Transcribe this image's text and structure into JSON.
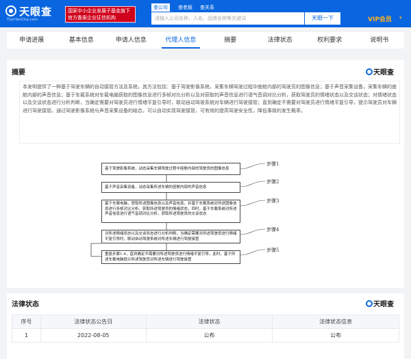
{
  "header": {
    "logo_text": "天眼查",
    "logo_sub": "TianYanCha.com",
    "banner_line1": "国家中小企业发展子基金旗下",
    "banner_line2": "官方备案企业征信机构",
    "search_tabs": [
      "查公司",
      "查老板",
      "查关系"
    ],
    "search_placeholder": "请输入公司名称、人名、品牌名称等关键词",
    "search_button": "天眼一下",
    "vip_label": "VIP会员",
    "brand_color": "#0a66e0"
  },
  "tabs": [
    {
      "label": "申请进展"
    },
    {
      "label": "基本信息"
    },
    {
      "label": "申请人信息"
    },
    {
      "label": "代理人信息"
    },
    {
      "label": "摘要"
    },
    {
      "label": "法律状态"
    },
    {
      "label": "权利要求"
    },
    {
      "label": "说明书"
    }
  ],
  "abstract_section": {
    "title": "摘要",
    "badge": "天眼查",
    "text": "本发明提供了一种基于驾驶车辆的自动接管方法及系统，其方法包括：基于驾驶影像系统，采集车辆驾驶过程中座舱内部的驾驶员的图像信息；基于声音采集设备，采集车辆的座舱内部的声音信息；基于车载系统对车载电脑获取的图像信息进行多帧对比分析以及对获取的声音信息进行语气音调对比分析，获取驾驶员的情绪状态以及交谈状态；对情绪状态以及交谈状态进行分析判断，当确定需要对驾驶员进行情绪平复引导时，联动自动驾驶系统对车辆进行驾驶接管；直到确定不需要对驾驶员进行情绪平复引导，提示驾驶员对车辆进行驾驶接管。通过驾驶影像系统与声音采集设备的结合，可以自动实现驾驶接管，可有效的提高驾驶安全性，降低事故的发生概率。"
  },
  "flowchart": {
    "steps": [
      {
        "text": "基于驾驶影像系统，动态采集车辆驾驶过程中座舱内部的驾驶员的图像信息",
        "label": "步骤1"
      },
      {
        "text": "基于声音采集设备，动态采集所述车辆的座舱内部的声音信息",
        "label": "步骤2"
      },
      {
        "text": "基于车载电脑，获取所述图像信息以及声音信息，并基于车载系统对所述图像信息进行多帧对比分析，获取所述驾驶员的情绪状态，同时，基于车载系统对所述声音信息进行语气音调对比分析，获取所述驾驶员的交谈状态",
        "label": "步骤3"
      },
      {
        "text": "对所述情绪状态以及交谈状态进行分析判断，当确定需要对所述驾驶员进行情绪平复引导时，联动自动驾驶系统对所述车辆进行驾驶接管",
        "label": "步骤4"
      },
      {
        "text": "重复步骤1-4，直到确定不需要对所述驾驶员进行情绪平复引导，此时，基于所述车载电脑提示所述驾驶员对所述车辆进行驾驶接管",
        "label": "步骤5"
      }
    ]
  },
  "legal_section": {
    "title": "法律状态",
    "badge": "天眼查",
    "columns": [
      "序号",
      "法律状态公告日",
      "法律状态",
      "法律状态信息"
    ],
    "rows": [
      [
        "1",
        "2022-08-05",
        "公布",
        "公布"
      ]
    ]
  }
}
